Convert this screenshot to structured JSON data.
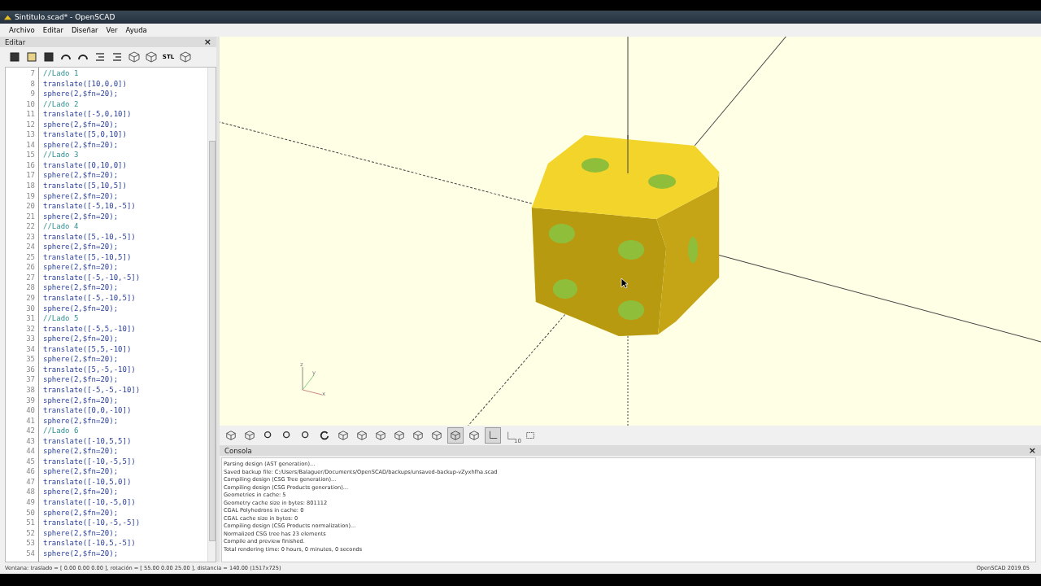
{
  "window": {
    "title": "Sintitulo.scad* - OpenSCAD"
  },
  "menu": [
    "Archivo",
    "Editar",
    "Diseñar",
    "Ver",
    "Ayuda"
  ],
  "editor": {
    "title": "Editar",
    "close": "×",
    "stl_label": "STL",
    "lines": [
      {
        "number": "7",
        "kind": "comment",
        "text": "//Lado 1"
      },
      {
        "number": "8",
        "kind": "code",
        "text": "translate([10,0,0])"
      },
      {
        "number": "9",
        "kind": "code",
        "text": "sphere(2,$fn=20);"
      },
      {
        "number": "10",
        "kind": "comment",
        "text": "//Lado 2"
      },
      {
        "number": "11",
        "kind": "code",
        "text": "translate([-5,0,10])"
      },
      {
        "number": "12",
        "kind": "code",
        "text": "sphere(2,$fn=20);"
      },
      {
        "number": "13",
        "kind": "code",
        "text": "translate([5,0,10])"
      },
      {
        "number": "14",
        "kind": "code",
        "text": "sphere(2,$fn=20);"
      },
      {
        "number": "15",
        "kind": "comment",
        "text": "//Lado 3"
      },
      {
        "number": "16",
        "kind": "code",
        "text": "translate([0,10,0])"
      },
      {
        "number": "17",
        "kind": "code",
        "text": "sphere(2,$fn=20);"
      },
      {
        "number": "18",
        "kind": "code",
        "text": "translate([5,10,5])"
      },
      {
        "number": "19",
        "kind": "code",
        "text": "sphere(2,$fn=20);"
      },
      {
        "number": "20",
        "kind": "code",
        "text": "translate([-5,10,-5])"
      },
      {
        "number": "21",
        "kind": "code",
        "text": "sphere(2,$fn=20);"
      },
      {
        "number": "22",
        "kind": "comment",
        "text": "//Lado 4"
      },
      {
        "number": "23",
        "kind": "code",
        "text": "translate([5,-10,-5])"
      },
      {
        "number": "24",
        "kind": "code",
        "text": "sphere(2,$fn=20);"
      },
      {
        "number": "25",
        "kind": "code",
        "text": "translate([5,-10,5])"
      },
      {
        "number": "26",
        "kind": "code",
        "text": "sphere(2,$fn=20);"
      },
      {
        "number": "27",
        "kind": "code",
        "text": "translate([-5,-10,-5])"
      },
      {
        "number": "28",
        "kind": "code",
        "text": "sphere(2,$fn=20);"
      },
      {
        "number": "29",
        "kind": "code",
        "text": "translate([-5,-10,5])"
      },
      {
        "number": "30",
        "kind": "code",
        "text": "sphere(2,$fn=20);"
      },
      {
        "number": "31",
        "kind": "comment",
        "text": "//Lado 5"
      },
      {
        "number": "32",
        "kind": "code",
        "text": "translate([-5,5,-10])"
      },
      {
        "number": "33",
        "kind": "code",
        "text": "sphere(2,$fn=20);"
      },
      {
        "number": "34",
        "kind": "code",
        "text": "translate([5,5,-10])"
      },
      {
        "number": "35",
        "kind": "code",
        "text": "sphere(2,$fn=20);"
      },
      {
        "number": "36",
        "kind": "code",
        "text": "translate([5,-5,-10])"
      },
      {
        "number": "37",
        "kind": "code",
        "text": "sphere(2,$fn=20);"
      },
      {
        "number": "38",
        "kind": "code",
        "text": "translate([-5,-5,-10])"
      },
      {
        "number": "39",
        "kind": "code",
        "text": "sphere(2,$fn=20);"
      },
      {
        "number": "40",
        "kind": "code",
        "text": "translate([0,0,-10])"
      },
      {
        "number": "41",
        "kind": "code",
        "text": "sphere(2,$fn=20);"
      },
      {
        "number": "42",
        "kind": "comment",
        "text": "//Lado 6"
      },
      {
        "number": "43",
        "kind": "code",
        "text": "translate([-10,5,5])"
      },
      {
        "number": "44",
        "kind": "code",
        "text": "sphere(2,$fn=20);"
      },
      {
        "number": "45",
        "kind": "code",
        "text": "translate([-10,-5,5])"
      },
      {
        "number": "46",
        "kind": "code",
        "text": "sphere(2,$fn=20);"
      },
      {
        "number": "47",
        "kind": "code",
        "text": "translate([-10,5,0])"
      },
      {
        "number": "48",
        "kind": "code",
        "text": "sphere(2,$fn=20);"
      },
      {
        "number": "49",
        "kind": "code",
        "text": "translate([-10,-5,0])"
      },
      {
        "number": "50",
        "kind": "code",
        "text": "sphere(2,$fn=20);"
      },
      {
        "number": "51",
        "kind": "code",
        "text": "translate([-10,-5,-5])"
      },
      {
        "number": "52",
        "kind": "code",
        "text": "sphere(2,$fn=20);"
      },
      {
        "number": "53",
        "kind": "code",
        "text": "translate([-10,5,-5])"
      },
      {
        "number": "54",
        "kind": "code",
        "text": "sphere(2,$fn=20);"
      }
    ]
  },
  "viewport": {
    "axis_labels": [
      "z",
      "y",
      "x"
    ]
  },
  "viewer_toolbar": {
    "scale_label": "10",
    "buttons": [
      {
        "on": false
      },
      {
        "on": false
      },
      {
        "on": false
      },
      {
        "on": false
      },
      {
        "on": false
      },
      {
        "on": false
      },
      {
        "on": false
      },
      {
        "on": false
      },
      {
        "on": false
      },
      {
        "on": false
      },
      {
        "on": false
      },
      {
        "on": false
      },
      {
        "on": true
      },
      {
        "on": false
      },
      {
        "on": true
      },
      {
        "on": false
      },
      {
        "on": false
      }
    ]
  },
  "console": {
    "title": "Consola",
    "close": "×",
    "lines": [
      "Parsing design (AST generation)...",
      "Saved backup file: C:/Users/Balaguer/Documents/OpenSCAD/backups/unsaved-backup-vZyxhfha.scad",
      "Compiling design (CSG Tree generation)...",
      "Compiling design (CSG Products generation)...",
      "Geometries in cache: 5",
      "Geometry cache size in bytes: 801112",
      "CGAL Polyhedrons in cache: 0",
      "CGAL cache size in bytes: 0",
      "Compiling design (CSG Products normalization)...",
      "Normalized CSG tree has 23 elements",
      "Compile and preview finished.",
      "Total rendering time: 0 hours, 0 minutes, 0 seconds"
    ]
  },
  "status_bar": {
    "left": "Ventana: traslado = [ 0.00 0.00 0.00 ], rotación = [ 55.00 0.00 25.00 ], distancia = 140.00 (1517x725)",
    "right": "OpenSCAD 2019.05"
  }
}
